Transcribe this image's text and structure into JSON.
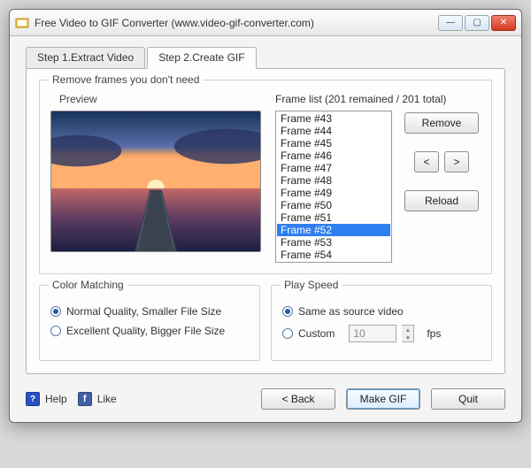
{
  "window": {
    "title": "Free Video to GIF Converter (www.video-gif-converter.com)"
  },
  "tabs": {
    "tab1": "Step 1.Extract Video",
    "tab2": "Step 2.Create GIF"
  },
  "frames_group": {
    "title": "Remove frames you don't need",
    "preview_label": "Preview",
    "list_label": "Frame list (201 remained / 201 total)",
    "remove_btn": "Remove",
    "prev_btn": "<",
    "next_btn": ">",
    "reload_btn": "Reload",
    "items": {
      "i0": "Frame #43",
      "i1": "Frame #44",
      "i2": "Frame #45",
      "i3": "Frame #46",
      "i4": "Frame #47",
      "i5": "Frame #48",
      "i6": "Frame #49",
      "i7": "Frame #50",
      "i8": "Frame #51",
      "i9": "Frame #52",
      "i10": "Frame #53",
      "i11": "Frame #54"
    }
  },
  "color_group": {
    "title": "Color Matching",
    "opt_normal": "Normal Quality, Smaller File Size",
    "opt_excellent": "Excellent Quality, Bigger File Size"
  },
  "speed_group": {
    "title": "Play Speed",
    "opt_source": "Same as source video",
    "opt_custom": "Custom",
    "fps_value": "10",
    "fps_label": "fps"
  },
  "footer": {
    "help": "Help",
    "like": "Like",
    "back": "< Back",
    "make": "Make GIF",
    "quit": "Quit"
  }
}
